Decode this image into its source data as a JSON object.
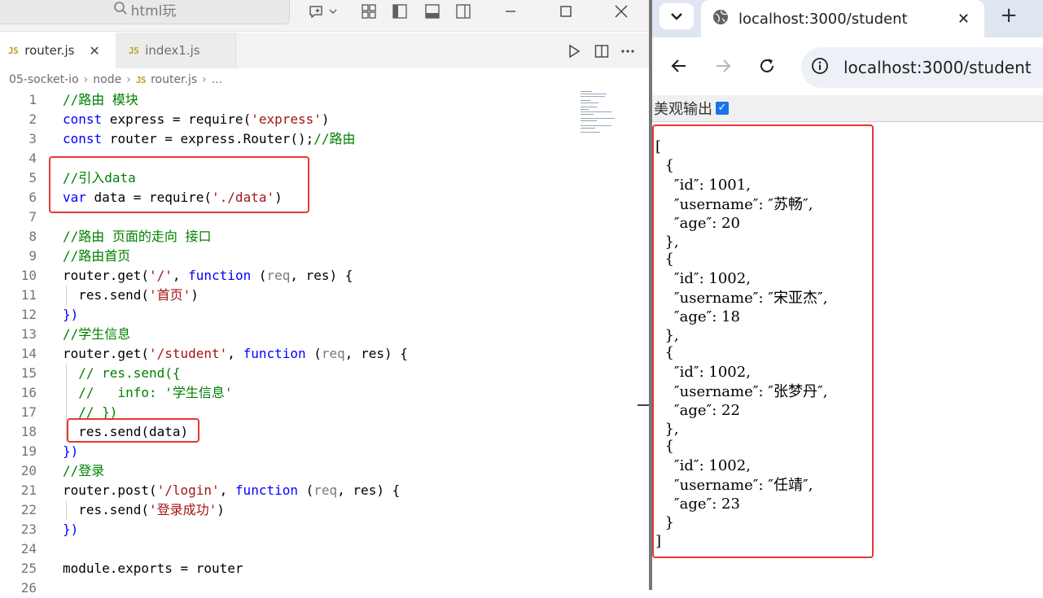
{
  "vscode": {
    "search_label": "html玩",
    "tabs": [
      {
        "badge": "JS",
        "label": "router.js",
        "close": "✕",
        "active": true
      },
      {
        "badge": "JS",
        "label": "index1.js",
        "active": false
      }
    ],
    "breadcrumb": [
      "05-socket-io",
      "node",
      "router.js",
      "..."
    ],
    "breadcrumb_badge": "JS",
    "code_lines": [
      {
        "n": "1"
      },
      {
        "n": "2"
      },
      {
        "n": "3"
      },
      {
        "n": "4"
      },
      {
        "n": "5"
      },
      {
        "n": "6"
      },
      {
        "n": "7"
      },
      {
        "n": "8"
      },
      {
        "n": "9"
      },
      {
        "n": "10"
      },
      {
        "n": "11"
      },
      {
        "n": "12"
      },
      {
        "n": "13"
      },
      {
        "n": "14"
      },
      {
        "n": "15"
      },
      {
        "n": "16"
      },
      {
        "n": "17"
      },
      {
        "n": "18"
      },
      {
        "n": "19"
      },
      {
        "n": "20"
      },
      {
        "n": "21"
      },
      {
        "n": "22"
      },
      {
        "n": "23"
      },
      {
        "n": "24"
      },
      {
        "n": "25"
      },
      {
        "n": "26"
      }
    ],
    "code_tokens": {
      "l1": "//路由 模块",
      "l2a": "const",
      "l2b": " express = require(",
      "l2c": "'express'",
      "l2d": ")",
      "l3a": "const",
      "l3b": " router = express.Router();",
      "l3c": "//路由",
      "l5": "//引入data",
      "l6a": "var",
      "l6b": " data = require(",
      "l6c": "'./data'",
      "l6d": ")",
      "l8": "//路由 页面的走向 接口",
      "l9": "//路由首页",
      "l10a": "router.get(",
      "l10b": "'/'",
      "l10c": ", ",
      "l10d": "function",
      "l10e": " (",
      "l10f": "req",
      "l10g": ", res) {",
      "l11a": "  res.send(",
      "l11b": "'首页'",
      "l11c": ")",
      "l12": "})",
      "l13": "//学生信息",
      "l14a": "router.get(",
      "l14b": "'/student'",
      "l14c": ", ",
      "l14d": "function",
      "l14e": " (",
      "l14f": "req",
      "l14g": ", res) {",
      "l15": "  // res.send({",
      "l16": "  //   info: '学生信息'",
      "l17": "  // })",
      "l18": "  res.send(data)",
      "l19": "})",
      "l20": "//登录",
      "l21a": "router.post(",
      "l21b": "'/login'",
      "l21c": ", ",
      "l21d": "function",
      "l21e": " (",
      "l21f": "req",
      "l21g": ", res) {",
      "l22a": "  res.send(",
      "l22b": "'登录成功'",
      "l22c": ")",
      "l23": "})",
      "l25": "module.exports = router"
    },
    "colors": {
      "comment": "#008000",
      "keyword": "#0000ff",
      "string": "#a31515",
      "highlight_box": "#e53935"
    }
  },
  "browser": {
    "tab_title": "localhost:3000/student",
    "tab_close": "✕",
    "new_tab": "+",
    "url": "localhost:3000/student",
    "pretty_print_label": "美观输出",
    "pretty_print_checked": true,
    "json_lines": [
      "[",
      "  {",
      "    ″id″: 1001,",
      "    ″username″: ″苏畅″,",
      "    ″age″: 20",
      "  },",
      "  {",
      "    ″id″: 1002,",
      "    ″username″: ″宋亚杰″,",
      "    ″age″: 18",
      "  },",
      "  {",
      "    ″id″: 1002,",
      "    ″username″: ″张梦丹″,",
      "    ″age″: 22",
      "  },",
      "  {",
      "    ″id″: 1002,",
      "    ″username″: ″任靖″,",
      "    ″age″: 23",
      "  }",
      "]"
    ]
  }
}
